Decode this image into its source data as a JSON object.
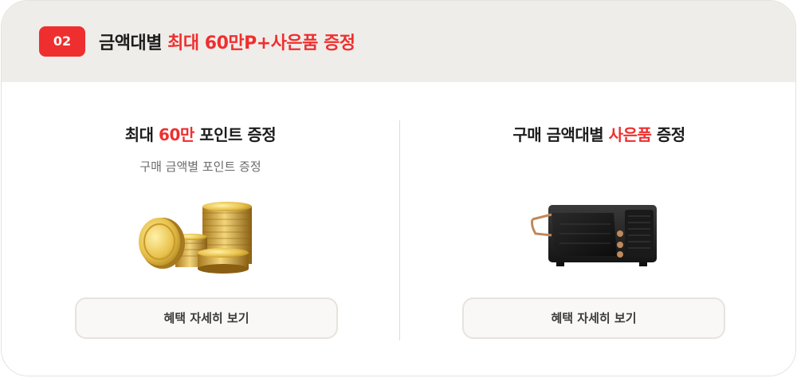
{
  "header": {
    "badge": "02",
    "title_plain": "금액대별",
    "title_accent": "최대 60만P+사은품 증정"
  },
  "panels": [
    {
      "title_pre": "최대 ",
      "title_accent": "60만",
      "title_post": " 포인트 증정",
      "subtitle": "구매 금액별 포인트 증정",
      "image_icon": "gold-coins",
      "button_label": "혜택 자세히 보기"
    },
    {
      "title_pre": "구매 금액대별 ",
      "title_accent": "사은품",
      "title_post": " 증정",
      "image_icon": "toaster-oven",
      "button_label": "혜택 자세히 보기"
    }
  ],
  "colors": {
    "accent": "#ef2f2f",
    "header_bg": "#efede9",
    "button_bg": "#f9f8f6"
  }
}
